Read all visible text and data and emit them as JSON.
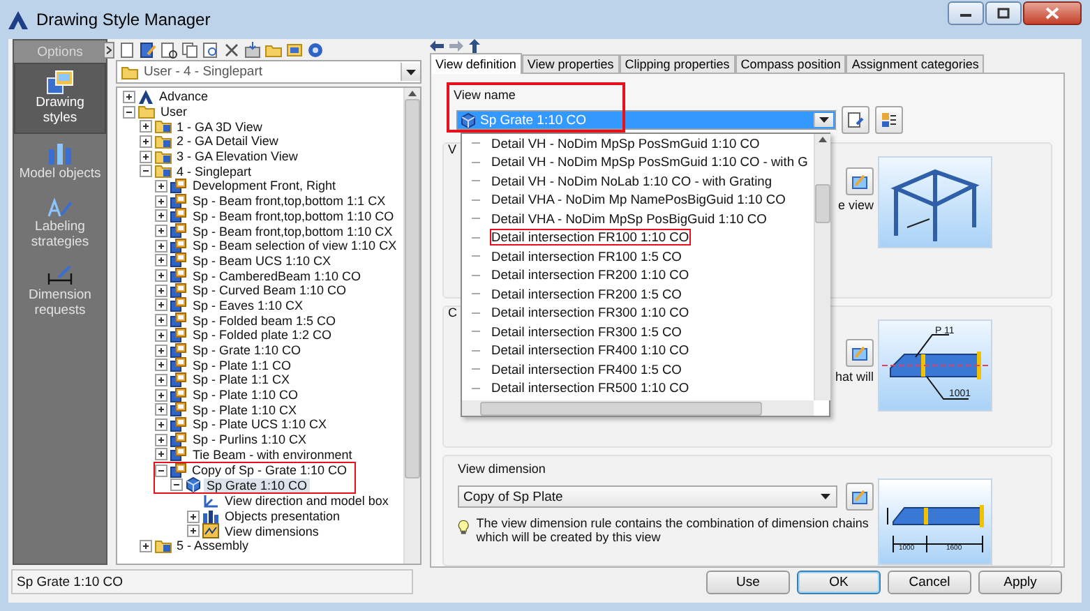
{
  "window": {
    "title": "Drawing Style Manager"
  },
  "sidebar": {
    "header": "Options",
    "items": [
      {
        "label": "Drawing styles",
        "kind": "styles",
        "selected": true
      },
      {
        "label": "Model objects",
        "kind": "objects",
        "selected": false
      },
      {
        "label": "Labeling strategies",
        "kind": "labeling",
        "selected": false
      },
      {
        "label": "Dimension requests",
        "kind": "dimension",
        "selected": false
      }
    ]
  },
  "path": {
    "value": "User - 4 - Singlepart"
  },
  "tree": [
    {
      "label": "Advance",
      "kind": "logo",
      "expanded": false,
      "selected": false,
      "highlighted": false
    },
    {
      "label": "User",
      "kind": "folder",
      "expanded": true,
      "selected": false,
      "highlighted": false,
      "children": [
        {
          "label": "1 - GA 3D View",
          "kind": "style-folder",
          "expanded": false,
          "selected": false,
          "highlighted": false
        },
        {
          "label": "2 - GA Detail View",
          "kind": "style-folder",
          "expanded": false,
          "selected": false,
          "highlighted": false
        },
        {
          "label": "3 - GA Elevation View",
          "kind": "style-folder",
          "expanded": false,
          "selected": false,
          "highlighted": false
        },
        {
          "label": "4 - Singlepart",
          "kind": "style-folder",
          "expanded": true,
          "selected": false,
          "highlighted": false,
          "children": [
            {
              "label": "Development Front, Right",
              "kind": "style",
              "expanded": false,
              "selected": false,
              "highlighted": false
            },
            {
              "label": "Sp - Beam front,top,bottom 1:1 CX",
              "kind": "style",
              "expanded": false,
              "selected": false,
              "highlighted": false
            },
            {
              "label": "Sp - Beam front,top,bottom 1:10 CO",
              "kind": "style",
              "expanded": false,
              "selected": false,
              "highlighted": false
            },
            {
              "label": "Sp - Beam front,top,bottom 1:10 CX",
              "kind": "style",
              "expanded": false,
              "selected": false,
              "highlighted": false
            },
            {
              "label": "Sp - Beam selection of view 1:10 CX",
              "kind": "style",
              "expanded": false,
              "selected": false,
              "highlighted": false
            },
            {
              "label": "Sp - Beam UCS 1:10 CX",
              "kind": "style",
              "expanded": false,
              "selected": false,
              "highlighted": false
            },
            {
              "label": "Sp - CamberedBeam 1:10 CO",
              "kind": "style",
              "expanded": false,
              "selected": false,
              "highlighted": false
            },
            {
              "label": "Sp - Curved Beam 1:10 CO",
              "kind": "style",
              "expanded": false,
              "selected": false,
              "highlighted": false
            },
            {
              "label": "Sp - Eaves 1:10 CX",
              "kind": "style",
              "expanded": false,
              "selected": false,
              "highlighted": false
            },
            {
              "label": "Sp - Folded beam 1:5 CO",
              "kind": "style",
              "expanded": false,
              "selected": false,
              "highlighted": false
            },
            {
              "label": "Sp - Folded plate 1:2 CO",
              "kind": "style",
              "expanded": false,
              "selected": false,
              "highlighted": false
            },
            {
              "label": "Sp - Grate 1:10 CO",
              "kind": "style",
              "expanded": false,
              "selected": false,
              "highlighted": false
            },
            {
              "label": "Sp - Plate 1:1 CO",
              "kind": "style",
              "expanded": false,
              "selected": false,
              "highlighted": false
            },
            {
              "label": "Sp - Plate 1:1 CX",
              "kind": "style",
              "expanded": false,
              "selected": false,
              "highlighted": false
            },
            {
              "label": "Sp - Plate 1:10 CO",
              "kind": "style",
              "expanded": false,
              "selected": false,
              "highlighted": false
            },
            {
              "label": "Sp - Plate 1:10 CX",
              "kind": "style",
              "expanded": false,
              "selected": false,
              "highlighted": false
            },
            {
              "label": "Sp - Plate UCS 1:10 CX",
              "kind": "style",
              "expanded": false,
              "selected": false,
              "highlighted": false
            },
            {
              "label": "Sp - Purlins 1:10 CX",
              "kind": "style",
              "expanded": false,
              "selected": false,
              "highlighted": false
            },
            {
              "label": "Tie Beam - with environment",
              "kind": "style",
              "expanded": false,
              "selected": false,
              "highlighted": false
            },
            {
              "label": "Copy of Sp - Grate 1:10 CO",
              "kind": "style",
              "expanded": true,
              "selected": false,
              "highlighted": true,
              "children": [
                {
                  "label": "Sp Grate 1:10 CO",
                  "kind": "view",
                  "expanded": true,
                  "selected": true,
                  "highlighted": true,
                  "children": [
                    {
                      "label": "View direction and model box",
                      "kind": "direction",
                      "selected": false,
                      "highlighted": false
                    },
                    {
                      "label": "Objects presentation",
                      "kind": "objects",
                      "expanded": false,
                      "selected": false,
                      "highlighted": false
                    },
                    {
                      "label": "View dimensions",
                      "kind": "dimensions",
                      "expanded": false,
                      "selected": false,
                      "highlighted": false
                    }
                  ]
                }
              ]
            }
          ]
        },
        {
          "label": "5 - Assembly",
          "kind": "style-folder",
          "expanded": false,
          "selected": false,
          "highlighted": false
        }
      ]
    }
  ],
  "status_bar": {
    "text": "Sp Grate 1:10 CO"
  },
  "tabs": [
    {
      "label": "View definition",
      "selected": true
    },
    {
      "label": "View properties",
      "selected": false
    },
    {
      "label": "Clipping properties",
      "selected": false
    },
    {
      "label": "Compass position",
      "selected": false
    },
    {
      "label": "Assignment categories",
      "selected": false
    }
  ],
  "view_name": {
    "label": "View name",
    "value": "Sp Grate 1:10 CO",
    "highlighted": true,
    "options": [
      {
        "label": "Detail VH - NoDim MpSp PosSmGuid 1:10 CO",
        "highlighted": false
      },
      {
        "label": "Detail VH - NoDim MpSp PosSmGuid 1:10 CO - with G",
        "highlighted": false
      },
      {
        "label": "Detail VH - NoDim NoLab 1:10 CO - with Grating",
        "highlighted": false
      },
      {
        "label": "Detail VHA - NoDim Mp NamePosBigGuid 1:10 CO",
        "highlighted": false
      },
      {
        "label": "Detail VHA - NoDim MpSp PosBigGuid 1:10 CO",
        "highlighted": false
      },
      {
        "label": "Detail intersection FR100 1:10 CO",
        "highlighted": true
      },
      {
        "label": "Detail intersection FR100 1:5 CO",
        "highlighted": false
      },
      {
        "label": "Detail intersection FR200 1:10 CO",
        "highlighted": false
      },
      {
        "label": "Detail intersection FR200 1:5 CO",
        "highlighted": false
      },
      {
        "label": "Detail intersection FR300 1:10 CO",
        "highlighted": false
      },
      {
        "label": "Detail intersection FR300 1:5 CO",
        "highlighted": false
      },
      {
        "label": "Detail intersection FR400 1:10 CO",
        "highlighted": false
      },
      {
        "label": "Detail intersection FR400 1:5 CO",
        "highlighted": false
      },
      {
        "label": "Detail intersection FR500 1:10 CO",
        "highlighted": false
      }
    ]
  },
  "groups": [
    {
      "title": "V",
      "description": "e view",
      "kind": "frame"
    },
    {
      "title": "C",
      "description": "hat will",
      "kind": "labels",
      "preview_labels": [
        "P 11",
        "1001"
      ]
    }
  ],
  "view_dimension": {
    "label": "View dimension",
    "value": "Copy of Sp Plate",
    "info": "The view dimension rule contains the combination of dimension chains which will be created by this view",
    "preview_labels": [
      "1000",
      "1600"
    ]
  },
  "buttons": [
    {
      "label": "Use",
      "default": false
    },
    {
      "label": "OK",
      "default": true
    },
    {
      "label": "Cancel",
      "default": false
    },
    {
      "label": "Apply",
      "default": false
    }
  ]
}
